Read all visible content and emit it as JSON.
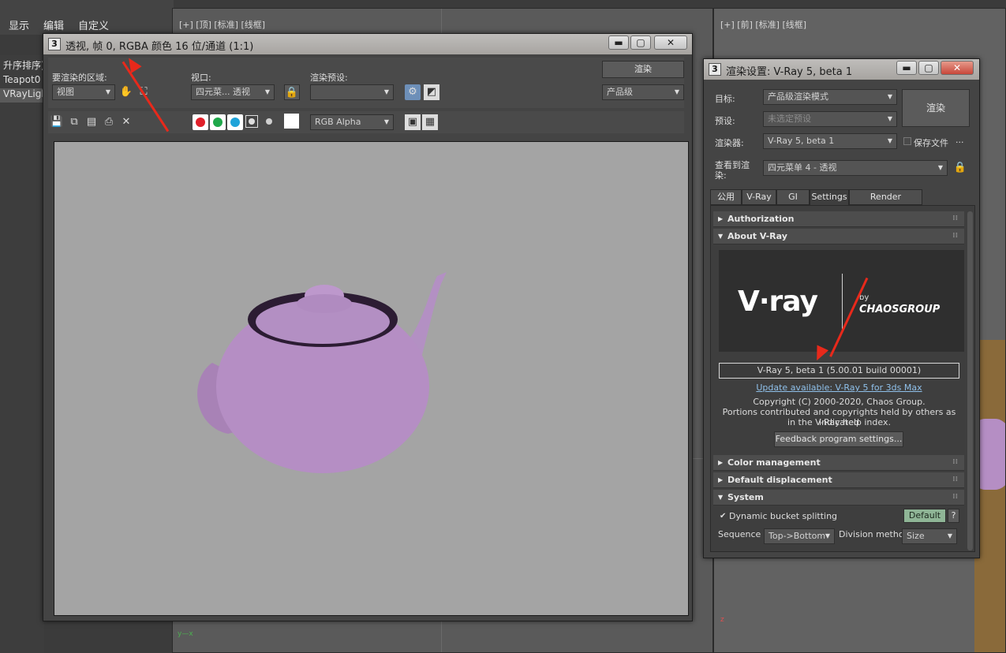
{
  "menu": [
    "显示",
    "编辑",
    "自定义"
  ],
  "scene_panel": {
    "header": "升序排序)",
    "items": [
      "Teapot0",
      "VRayLigh"
    ]
  },
  "viewports": {
    "top_label": "[+] [顶] [标准] [线框]",
    "front_label": "[+] [前] [标准] [线框]"
  },
  "render_frame": {
    "title": "透视, 帧 0, RGBA 颜色 16 位/通道 (1:1)",
    "area_label": "要渲染的区域:",
    "area_value": "视图",
    "viewport_label": "视口:",
    "viewport_value": "四元菜... 透视",
    "preset_label": "渲染预设:",
    "preset_value": "",
    "render_button": "渲染",
    "quality_value": "产品级",
    "channel_value": "RGB Alpha"
  },
  "render_settings": {
    "title": "渲染设置: V-Ray 5, beta 1",
    "target_label": "目标:",
    "target_value": "产品级渲染模式",
    "preset_label": "预设:",
    "preset_value": "未选定预设",
    "renderer_label": "渲染器:",
    "renderer_value": "V-Ray 5, beta 1",
    "save_file_label": "保存文件",
    "ellipsis": "...",
    "view_label_1": "查看到渲",
    "view_label_2": "染:",
    "view_value": "四元菜单 4 - 透视",
    "render_button": "渲染",
    "tabs": [
      "公用",
      "V-Ray",
      "GI",
      "Settings",
      "Render Elements"
    ],
    "rollouts": {
      "authorization": "Authorization",
      "about": "About V-Ray",
      "color": "Color management",
      "displacement": "Default displacement",
      "system": "System"
    },
    "about": {
      "vray_logo": "V·ray",
      "by": "by",
      "chaos_logo": "CHAOSGROUP",
      "version": "V-Ray 5, beta 1 (5.00.01 build 00001)",
      "update_link": "Update available: V-Ray 5 for 3ds Max",
      "copyright_1": "Copyright (C) 2000-2020, Chaos Group.",
      "copyright_2": "Portions contributed and copyrights held by others as indicated",
      "copyright_3": "in the V-Ray help index.",
      "feedback_button": "Feedback program settings..."
    },
    "system": {
      "dynamic_label": "Dynamic bucket splitting",
      "default_button": "Default",
      "help_button": "?",
      "sequence_label": "Sequence",
      "sequence_value": "Top->Bottom",
      "division_label": "Division method",
      "division_value": "Size"
    }
  },
  "colors": {
    "accent_red": "#e8291b",
    "teapot": "#b58ec4",
    "link": "#8fc0ea"
  }
}
